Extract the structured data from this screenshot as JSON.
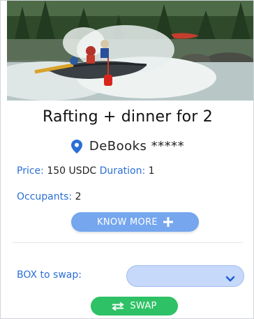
{
  "experience": {
    "title": "Rafting + dinner for 2",
    "provider": "DeBooks *****",
    "price_label": "Price:",
    "price_value": "150 USDC",
    "duration_label": "Duration:",
    "duration_value": "1",
    "occupants_label": "Occupants:",
    "occupants_value": "2",
    "photo_icon": "rafting-photo"
  },
  "actions": {
    "know_more_label": "KNOW MORE",
    "know_more_icon": "plus-icon",
    "swap_label": "SWAP",
    "swap_icon": "swap-arrows-icon"
  },
  "swap": {
    "box_label": "BOX to swap:",
    "selected_value": "",
    "dropdown_icon": "chevron-down-icon"
  },
  "colors": {
    "accent_blue": "#2b6fd6",
    "know_more_bg": "#75a6ee",
    "swap_green": "#2ec165",
    "select_bg": "#c7d9fb"
  }
}
